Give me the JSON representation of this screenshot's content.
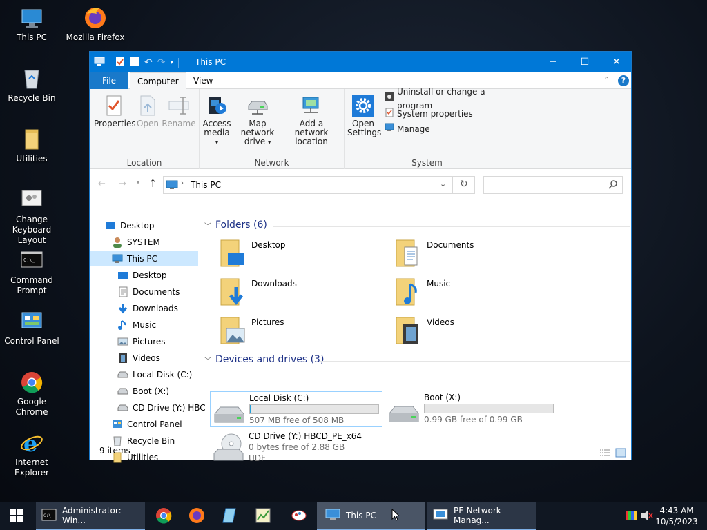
{
  "desktop": {
    "icons": [
      {
        "label": "This PC",
        "icon": "this-pc-icon"
      },
      {
        "label": "Mozilla Firefox",
        "icon": "firefox-icon"
      },
      {
        "label": "Recycle Bin",
        "icon": "recycle-bin-icon"
      },
      {
        "label": "Utilities",
        "icon": "folder-icon"
      },
      {
        "label": "Change Keyboard Layout",
        "icon": "keyboard-layout-icon"
      },
      {
        "label": "Command Prompt",
        "icon": "command-prompt-icon"
      },
      {
        "label": "Control Panel",
        "icon": "control-panel-icon"
      },
      {
        "label": "Google Chrome",
        "icon": "chrome-icon"
      },
      {
        "label": "Internet Explorer",
        "icon": "internet-explorer-icon"
      }
    ]
  },
  "window": {
    "title": "This PC",
    "controls": {
      "minimize": "─",
      "maximize": "☐",
      "close": "✕"
    },
    "menu_tabs": [
      "File",
      "Computer",
      "View"
    ],
    "ribbon": {
      "location": {
        "label": "Location",
        "properties": "Properties",
        "open": "Open",
        "rename": "Rename"
      },
      "network": {
        "label": "Network",
        "access_media_1": "Access",
        "access_media_2": "media",
        "map_drive_1": "Map network",
        "map_drive_2": "drive",
        "add_location_1": "Add a network",
        "add_location_2": "location"
      },
      "system": {
        "label": "System",
        "open_settings_1": "Open",
        "open_settings_2": "Settings",
        "uninstall": "Uninstall or change a program",
        "system_properties": "System properties",
        "manage": "Manage"
      }
    },
    "address": {
      "path": "This PC",
      "search_placeholder": ""
    },
    "nav": {
      "desktop": "Desktop",
      "system": "SYSTEM",
      "this_pc": "This PC",
      "pc_desktop": "Desktop",
      "documents": "Documents",
      "downloads": "Downloads",
      "music": "Music",
      "pictures": "Pictures",
      "videos": "Videos",
      "local_disk": "Local Disk (C:)",
      "boot": "Boot (X:)",
      "cd_drive": "CD Drive (Y:) HBC",
      "control_panel": "Control Panel",
      "recycle_bin": "Recycle Bin",
      "utilities": "Utilities"
    },
    "folders_header": "Folders (6)",
    "folders": [
      "Desktop",
      "Documents",
      "Downloads",
      "Music",
      "Pictures",
      "Videos"
    ],
    "drives_header": "Devices and drives (3)",
    "drives": [
      {
        "name": "Local Disk (C:)",
        "free": "507 MB free of 508 MB",
        "used_fraction": 0.002
      },
      {
        "name": "Boot (X:)",
        "free": "0.99 GB free of 0.99 GB",
        "used_fraction": 0.0
      },
      {
        "name": "CD Drive (Y:) HBCD_PE_x64",
        "free": "0 bytes free of 2.88 GB",
        "fs": "UDF"
      }
    ],
    "status": "9 items"
  },
  "taskbar": {
    "items": [
      {
        "label": "Administrator: Win...",
        "icon": "command-prompt-icon"
      },
      {
        "label": "This PC",
        "icon": "this-pc-icon"
      },
      {
        "label": "PE Network Manag...",
        "icon": "network-manager-icon"
      }
    ],
    "pinned": [
      "chrome-icon",
      "firefox-icon",
      "notepad-icon",
      "task-manager-icon",
      "paint-icon"
    ],
    "time": "4:43 AM",
    "date": "10/5/2023"
  },
  "colors": {
    "titlebar": "#0078d7",
    "selection": "#cce8ff",
    "drive_bar": "#26a0da",
    "section_header": "#1e3287"
  }
}
